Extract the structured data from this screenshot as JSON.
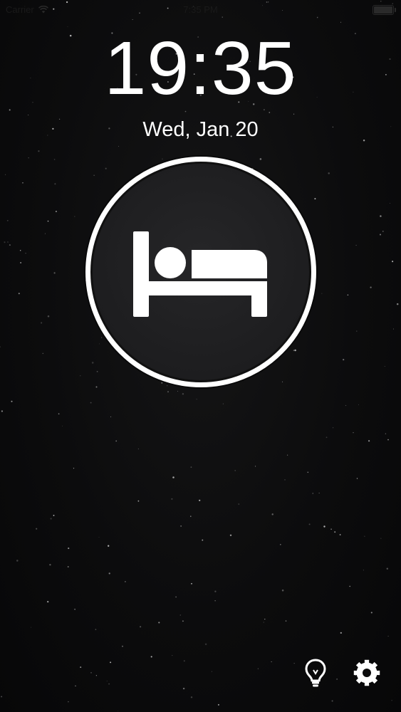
{
  "status_bar": {
    "carrier": "Carrier",
    "time": "7:35 PM"
  },
  "clock": {
    "time": "19:35",
    "date": "Wed, Jan 20"
  },
  "sleep_button": {
    "icon": "bed-icon"
  },
  "toolbar": {
    "left_icon": "lightbulb-icon",
    "right_icon": "gear-icon"
  },
  "colors": {
    "background": "#0b0b0c",
    "button_fill": "#1f1f21",
    "ring": "#ffffff",
    "foreground": "#ffffff"
  }
}
